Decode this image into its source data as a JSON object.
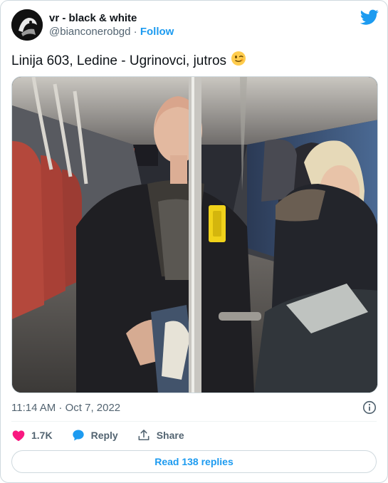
{
  "author": {
    "display_name": "vr - black & white",
    "handle": "@bianconerobgd",
    "separator": "·",
    "follow_label": "Follow"
  },
  "tweet": {
    "text": "Linija 603, Ledine - Ugrinovci, jutros",
    "emoji": "😉",
    "timestamp": "11:14 AM · Oct 7, 2022"
  },
  "actions": {
    "likes": "1.7K",
    "reply_label": "Reply",
    "share_label": "Share"
  },
  "read_replies_label": "Read 138 replies",
  "icons": {
    "twitter": "twitter-bird-icon",
    "info": "info-icon",
    "like": "heart-icon",
    "reply": "speech-bubble-icon",
    "share": "share-upload-icon"
  },
  "colors": {
    "accent": "#1d9bf0",
    "like": "#f91880",
    "text": "#0f1419",
    "muted": "#536471",
    "border": "#cfd9de"
  }
}
